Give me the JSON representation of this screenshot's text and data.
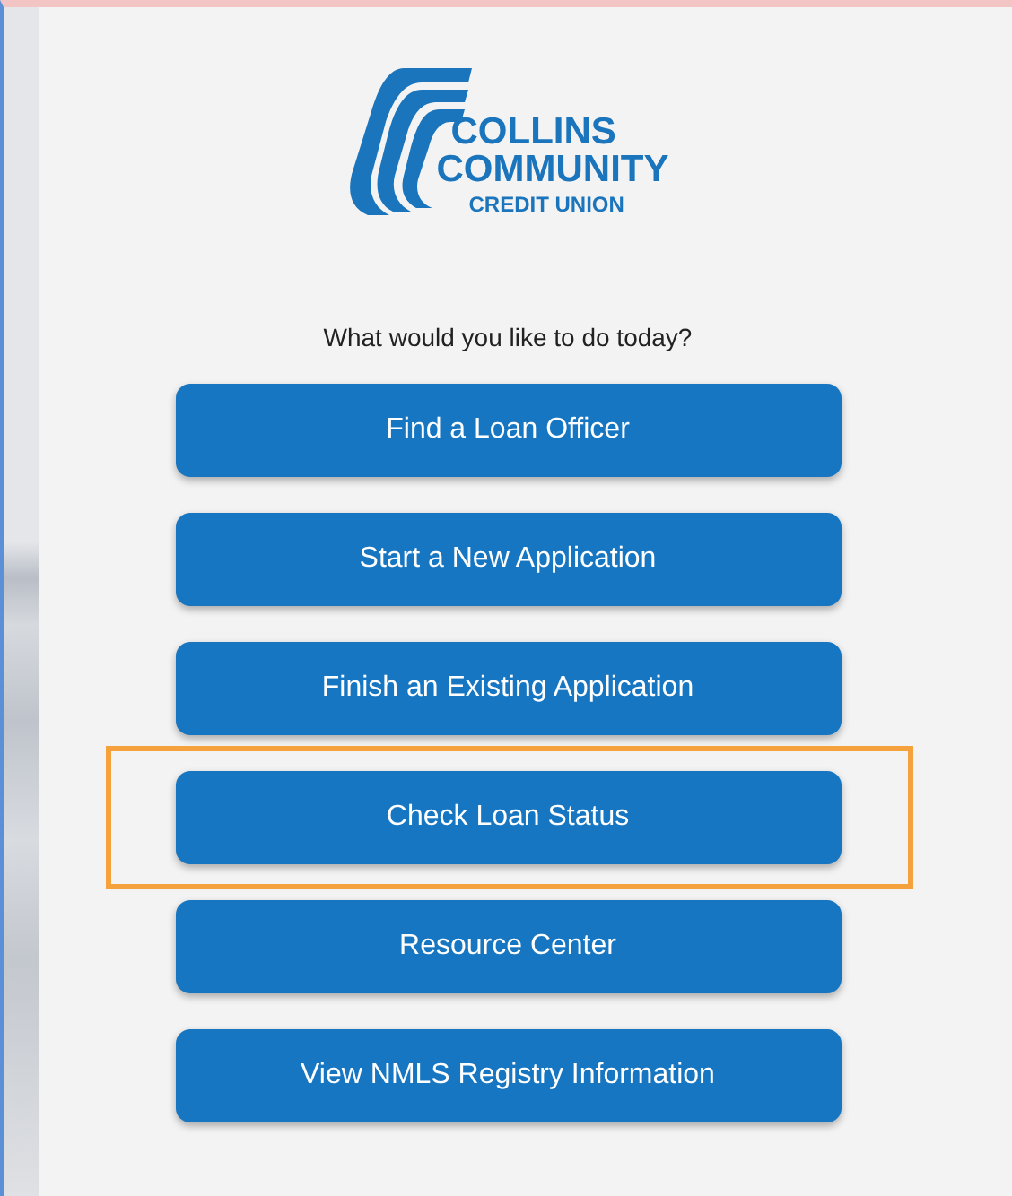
{
  "logo": {
    "lines": [
      "COLLINS",
      "COMMUNITY",
      "CREDIT UNION"
    ]
  },
  "prompt": "What would you like to do today?",
  "buttons": [
    {
      "label": "Find a Loan Officer",
      "highlighted": false
    },
    {
      "label": "Start a New Application",
      "highlighted": false
    },
    {
      "label": "Finish an Existing Application",
      "highlighted": false
    },
    {
      "label": "Check Loan Status",
      "highlighted": true
    },
    {
      "label": "Resource Center",
      "highlighted": false
    },
    {
      "label": "View NMLS Registry Information",
      "highlighted": false
    }
  ]
}
